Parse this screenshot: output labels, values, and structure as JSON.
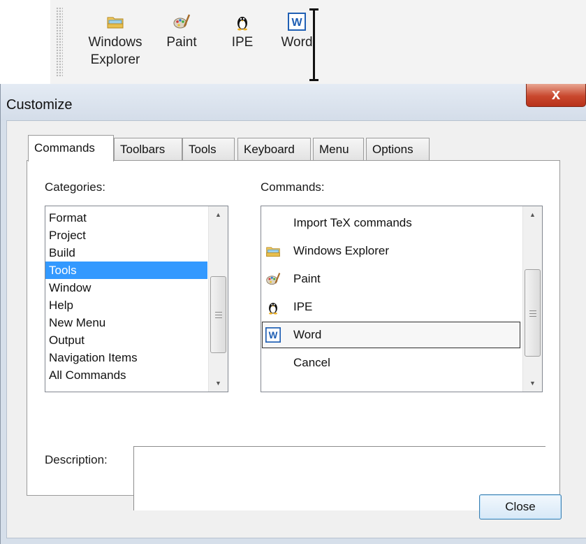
{
  "toolbar": {
    "buttons": [
      {
        "label": "Windows Explorer",
        "icon": "windows-explorer-icon"
      },
      {
        "label": "Paint",
        "icon": "paint-palette-icon"
      },
      {
        "label": "IPE",
        "icon": "penguin-icon"
      },
      {
        "label": "Word",
        "icon": "word-icon"
      }
    ]
  },
  "dialog": {
    "title": "Customize",
    "close_glyph": "x",
    "tabs": [
      "Commands",
      "Toolbars",
      "Tools",
      "Keyboard",
      "Menu",
      "Options"
    ],
    "active_tab": "Commands",
    "categories_label": "Categories:",
    "categories": [
      "Format",
      "Project",
      "Build",
      "Tools",
      "Window",
      "Help",
      "New Menu",
      "Output",
      "Navigation Items",
      "All Commands"
    ],
    "selected_category": "Tools",
    "commands_label": "Commands:",
    "commands": [
      {
        "label": "Import TeX commands",
        "icon": ""
      },
      {
        "label": "Windows Explorer",
        "icon": "windows-explorer-icon"
      },
      {
        "label": "Paint",
        "icon": "paint-palette-icon"
      },
      {
        "label": "IPE",
        "icon": "penguin-icon"
      },
      {
        "label": "Word",
        "icon": "word-icon"
      },
      {
        "label": "Cancel",
        "icon": ""
      }
    ],
    "focused_command": "Word",
    "description_label": "Description:",
    "description_text": "",
    "close_button": "Close"
  },
  "colors": {
    "selection": "#3399ff",
    "window_frame": "#d6dfea",
    "close_button_red": "#c9482e",
    "word_blue": "#1f5fb4"
  }
}
